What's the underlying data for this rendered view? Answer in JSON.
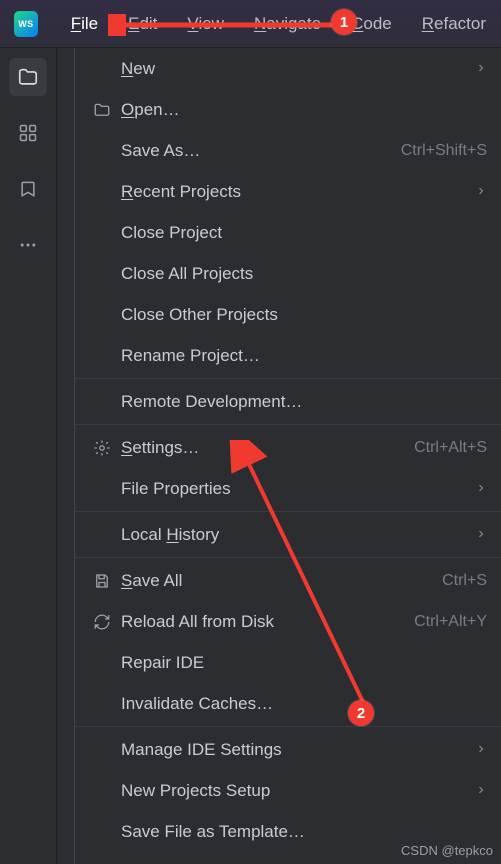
{
  "logo_text": "WS",
  "menubar": [
    {
      "label": "File",
      "mnemonic": "F",
      "active": true
    },
    {
      "label": "Edit",
      "mnemonic": "E"
    },
    {
      "label": "View",
      "mnemonic": "V"
    },
    {
      "label": "Navigate",
      "mnemonic": "N"
    },
    {
      "label": "Code",
      "mnemonic": "C"
    },
    {
      "label": "Refactor",
      "mnemonic": "R"
    }
  ],
  "file_menu": {
    "groups": [
      [
        {
          "label": "New",
          "mnemonic": "N",
          "submenu": true
        },
        {
          "label": "Open…",
          "mnemonic": "O",
          "icon": "folder"
        },
        {
          "label": "Save As…",
          "shortcut": "Ctrl+Shift+S"
        },
        {
          "label": "Recent Projects",
          "mnemonic": "R",
          "submenu": true
        },
        {
          "label": "Close Project"
        },
        {
          "label": "Close All Projects"
        },
        {
          "label": "Close Other Projects"
        },
        {
          "label": "Rename Project…"
        }
      ],
      [
        {
          "label": "Remote Development…"
        }
      ],
      [
        {
          "label": "Settings…",
          "mnemonic": "S",
          "icon": "gear",
          "shortcut": "Ctrl+Alt+S"
        },
        {
          "label": "File Properties",
          "submenu": true
        }
      ],
      [
        {
          "label": "Local History",
          "mnemonic": "H",
          "submenu": true
        }
      ],
      [
        {
          "label": "Save All",
          "mnemonic": "S",
          "icon": "save",
          "shortcut": "Ctrl+S"
        },
        {
          "label": "Reload All from Disk",
          "icon": "reload",
          "shortcut": "Ctrl+Alt+Y"
        },
        {
          "label": "Repair IDE"
        },
        {
          "label": "Invalidate Caches…"
        }
      ],
      [
        {
          "label": "Manage IDE Settings",
          "submenu": true
        },
        {
          "label": "New Projects Setup",
          "submenu": true
        },
        {
          "label": "Save File as Template…"
        }
      ]
    ]
  },
  "annotations": {
    "badge1": "1",
    "badge2": "2"
  },
  "watermark": "CSDN @tepkco"
}
